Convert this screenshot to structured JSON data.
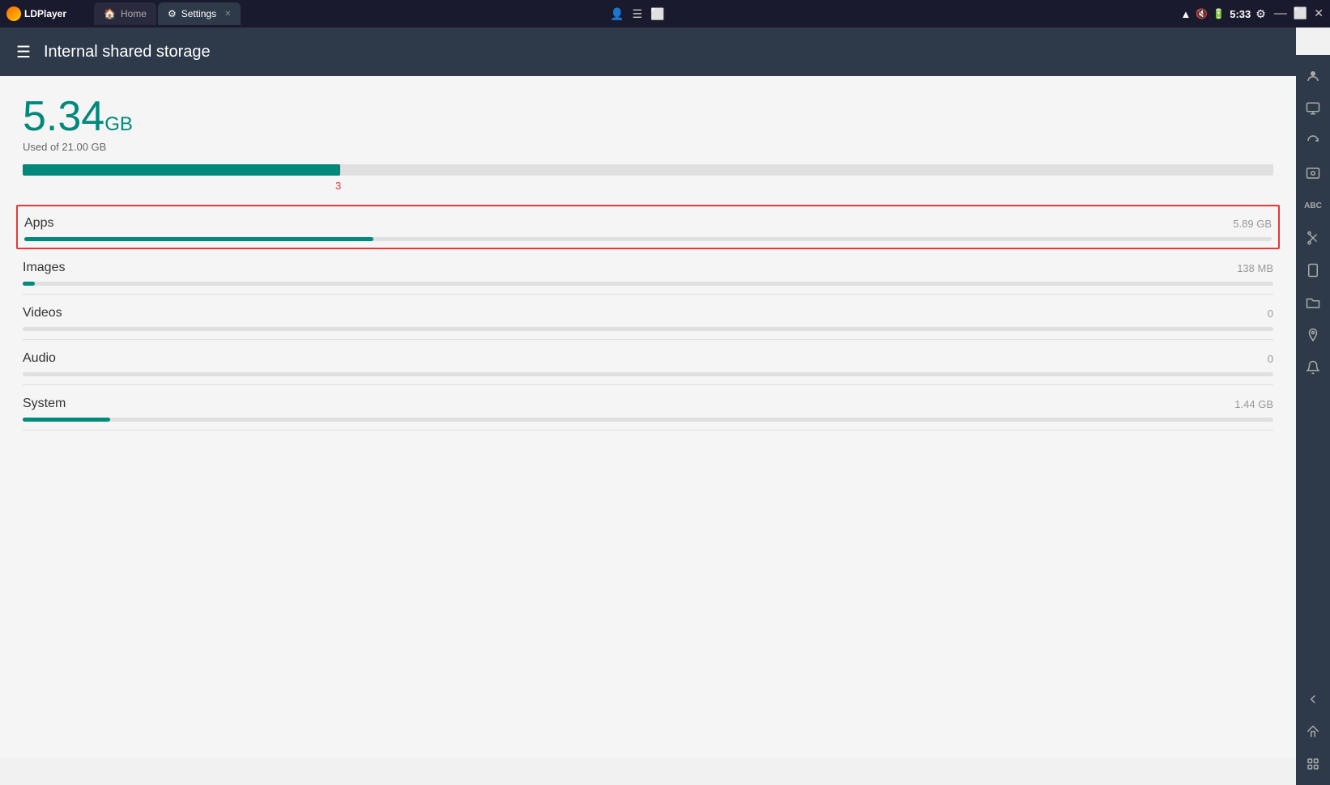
{
  "titlebar": {
    "logo_text": "LDPlayer",
    "tabs": [
      {
        "id": "home",
        "label": "Home",
        "icon": "🏠",
        "active": false,
        "closable": false
      },
      {
        "id": "settings",
        "label": "Settings",
        "icon": "⚙",
        "active": true,
        "closable": true
      }
    ],
    "controls": [
      "👤",
      "☰",
      "⬜",
      "—",
      "⬜",
      "✕"
    ],
    "status": {
      "wifi": "📶",
      "mute": "🔇",
      "battery": "🔋",
      "time": "5:33",
      "settings": "⚙"
    }
  },
  "header": {
    "menu_icon": "☰",
    "title": "Internal shared storage"
  },
  "storage": {
    "used_amount": "5.34",
    "used_unit": "GB",
    "used_label": "Used of 21.00 GB",
    "bar_percent": 25.4,
    "bar_marker": "3"
  },
  "categories": [
    {
      "name": "Apps",
      "size": "5.89 GB",
      "percent": 28,
      "highlighted": true
    },
    {
      "name": "Images",
      "size": "138 MB",
      "percent": 1,
      "highlighted": false
    },
    {
      "name": "Videos",
      "size": "0",
      "percent": 0,
      "highlighted": false
    },
    {
      "name": "Audio",
      "size": "0",
      "percent": 0,
      "highlighted": false
    },
    {
      "name": "System",
      "size": "1.44 GB",
      "percent": 7,
      "highlighted": false
    }
  ],
  "sidebar_buttons": [
    {
      "icon": "👤",
      "name": "user-icon"
    },
    {
      "icon": "⬜",
      "name": "screen-icon"
    },
    {
      "icon": "↺",
      "name": "rotate-icon"
    },
    {
      "icon": "📷",
      "name": "screenshot-icon"
    },
    {
      "icon": "ABC",
      "name": "keyboard-icon"
    },
    {
      "icon": "✂",
      "name": "scissor-icon"
    },
    {
      "icon": "📱",
      "name": "phone-icon"
    },
    {
      "icon": "📁",
      "name": "folder-icon"
    },
    {
      "icon": "📍",
      "name": "location-icon"
    },
    {
      "icon": "🔔",
      "name": "notification-icon"
    }
  ]
}
